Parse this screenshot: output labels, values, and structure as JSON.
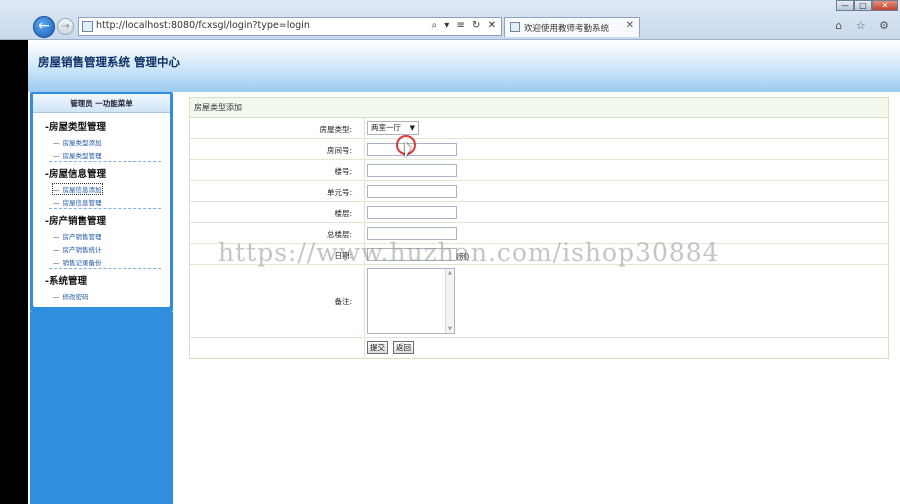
{
  "browser": {
    "window_buttons": [
      "—",
      "□",
      "✕"
    ],
    "back_icon": "←",
    "forward_icon": "→",
    "url": "http://localhost:8080/fcxsgl/login?type=login",
    "addr_tools": "⌕ ▾ ≡ ↻ ✕",
    "tab_title": "欢迎使用教师考勤系统",
    "tab_close": "✕",
    "toolbar_icons": "⌂ ☆ ⚙"
  },
  "header": {
    "system_title": "房屋销售管理系统  管理中心"
  },
  "sidebar": {
    "heading": "管理员   一功能菜单",
    "groups": [
      {
        "title": "-房屋类型管理",
        "items": [
          "房屋类型添加",
          "房屋类型管理"
        ]
      },
      {
        "title": "-房屋信息管理",
        "items": [
          "房屋信息添加",
          "房屋信息管理"
        ]
      },
      {
        "title": "-房产销售管理",
        "items": [
          "房产销售管理",
          "房产销售统计",
          "销售记录备份"
        ]
      },
      {
        "title": "-系统管理",
        "items": [
          "修改密码"
        ]
      }
    ]
  },
  "form": {
    "title": "房屋类型添加",
    "house_type_label": "房屋类型:",
    "house_type_value": "两室一厅",
    "house_type_arrow": "▼",
    "room_no_label": "房间号:",
    "building_label": "楼号:",
    "unit_label": "单元号:",
    "floor_label": "楼层:",
    "total_floors_label": "总楼层:",
    "date_label": "日期:",
    "date_hint": "(例)",
    "remark_label": "备注:",
    "submit_label": "提交",
    "back_label": "返回",
    "scroll_up": "▲",
    "scroll_down": "▼"
  },
  "watermark": "https://www.huzhan.com/ishop30884",
  "colors": {
    "sidebar_blue": "#2f8fde",
    "banner_title": "#0d2f66",
    "link_blue": "#1f56a8",
    "form_border": "#d5dfc3"
  }
}
